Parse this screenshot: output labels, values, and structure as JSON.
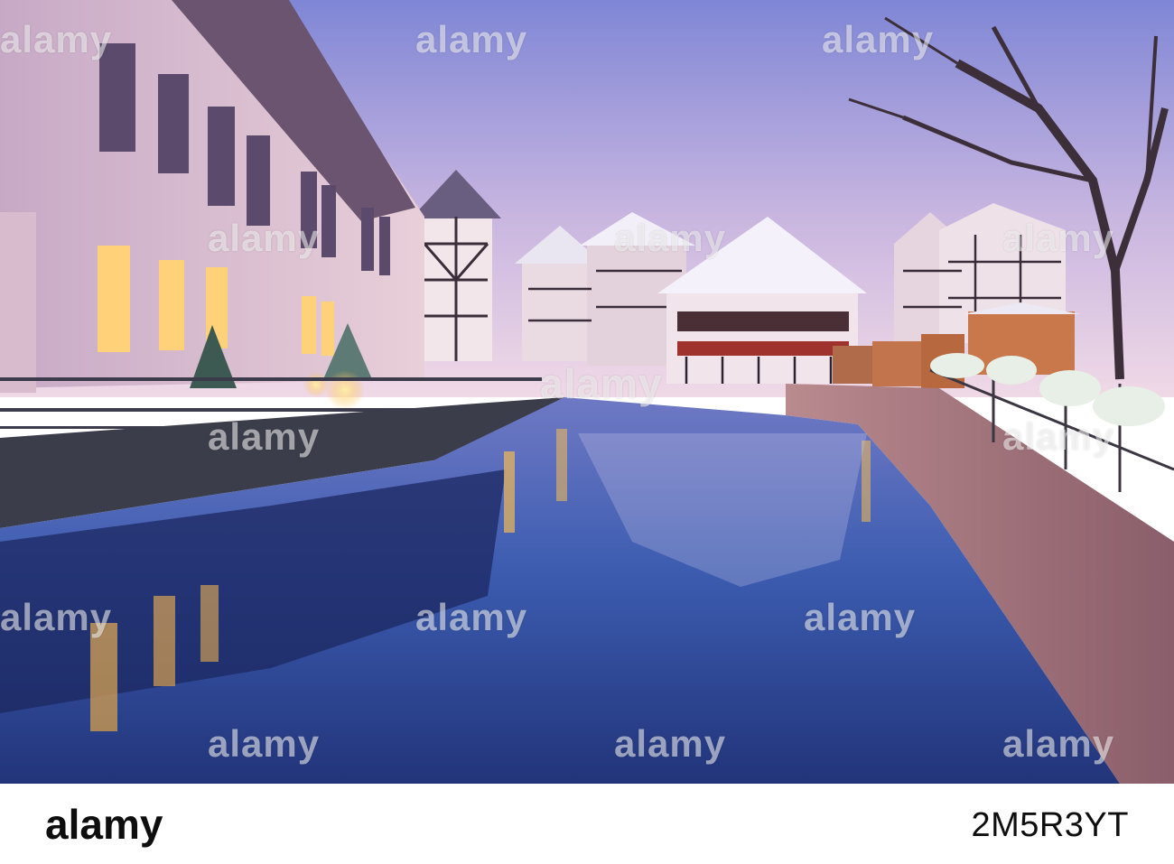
{
  "photo": {
    "scene": "winter-canal-half-timbered-houses-dusk",
    "colors": {
      "sky_top": "#7f86d6",
      "sky_bottom": "#f0d9e6",
      "water": "#2e4fa0",
      "window_glow": "#ffb63d"
    }
  },
  "watermark": {
    "text": "alamy",
    "repeats": [
      "alamy",
      "alamy",
      "alamy",
      "alamy",
      "alamy",
      "alamy",
      "alamy",
      "alamy",
      "alamy",
      "alamy",
      "alamy",
      "alamy",
      "alamy",
      "alamy",
      "alamy"
    ]
  },
  "footer": {
    "logo": "alamy",
    "image_id": "2M5R3YT"
  }
}
